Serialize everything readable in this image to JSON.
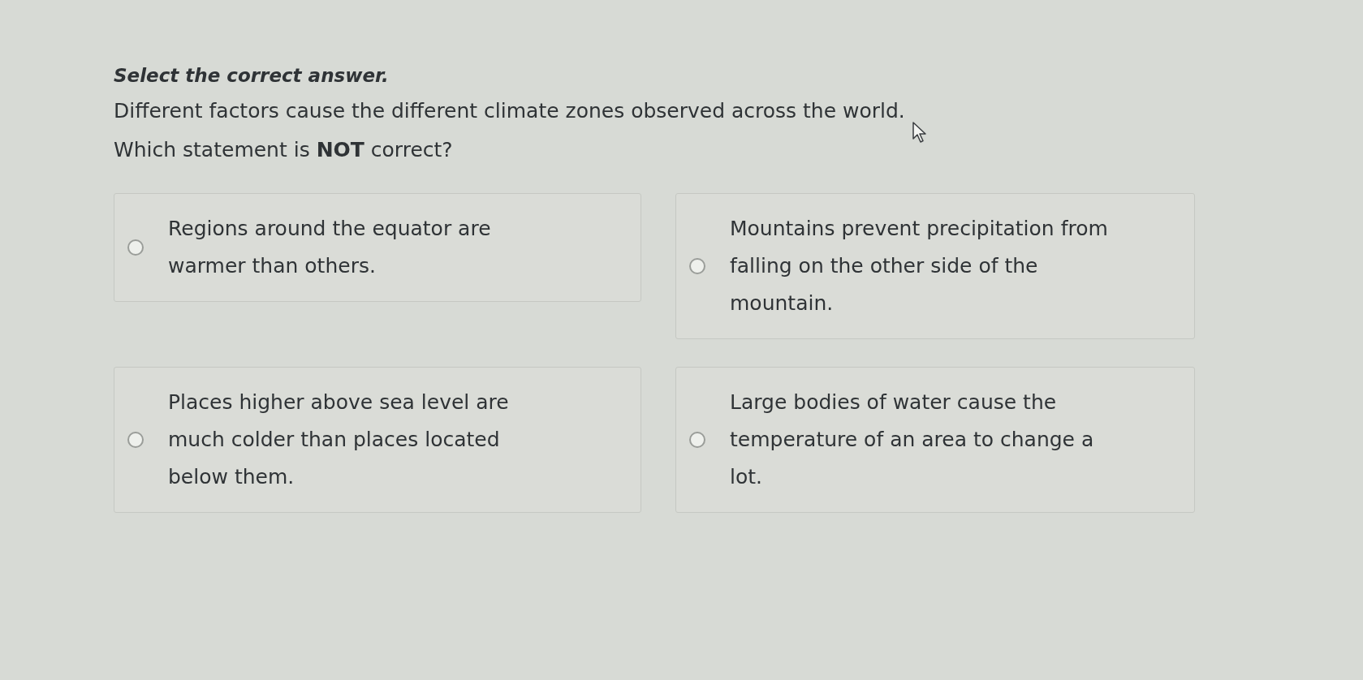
{
  "instruction": "Select the correct answer.",
  "question": [
    "Different factors cause the different climate zones observed across the world.",
    "Which statement is **NOT** correct?"
  ],
  "options": [
    {
      "text": "Regions around the equator are warmer than others.",
      "selected": false
    },
    {
      "text": "Mountains prevent precipitation from falling on the other side of the mountain.",
      "selected": false
    },
    {
      "text": "Places higher above sea level are much colder than places located below them.",
      "selected": false
    },
    {
      "text": "Large bodies of water cause the temperature of an area to change a lot.",
      "selected": false
    }
  ]
}
